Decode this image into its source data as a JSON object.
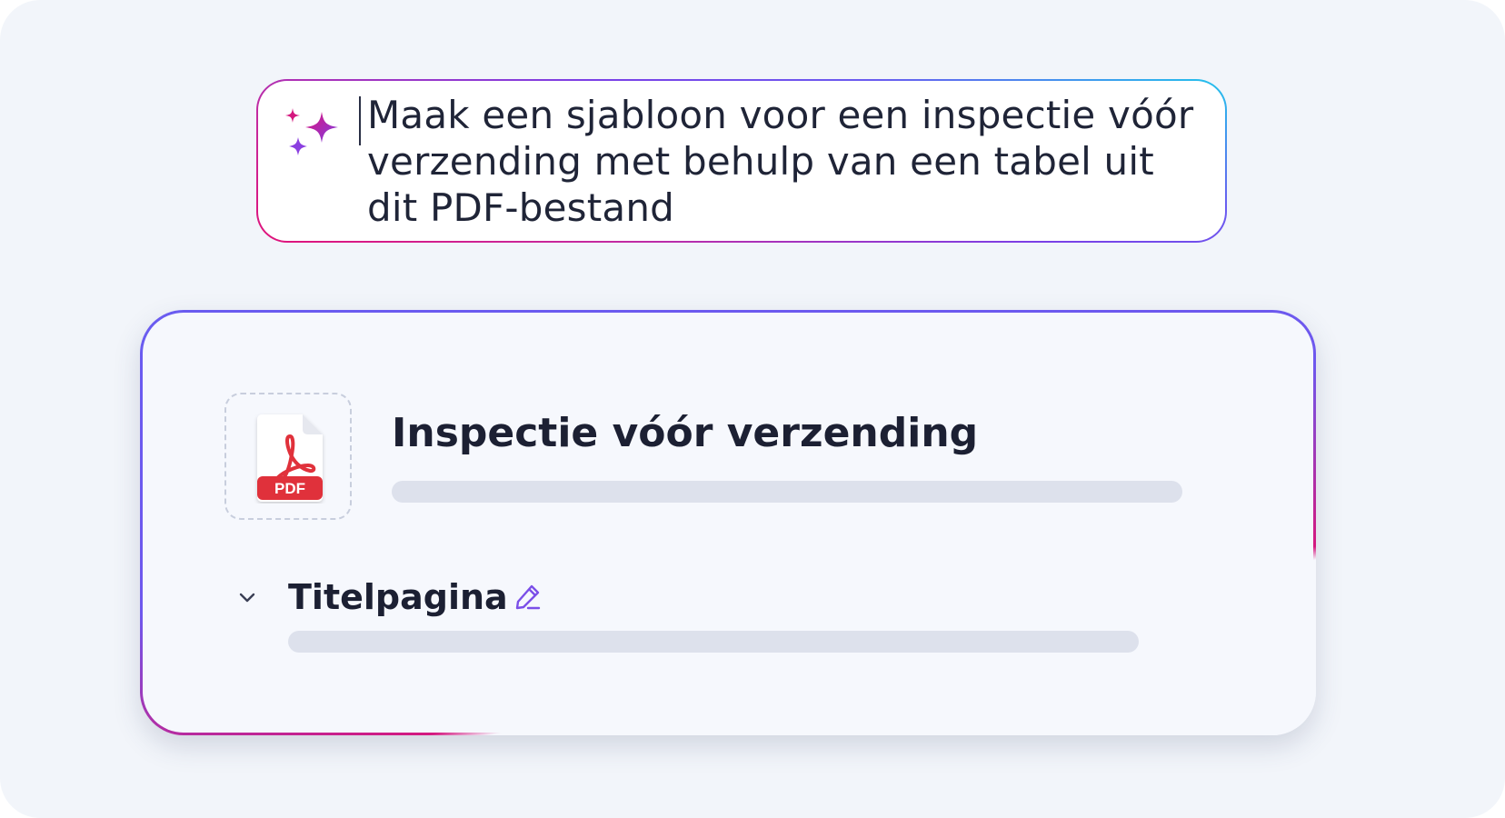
{
  "prompt": {
    "text": "Maak een sjabloon voor een inspectie vóór verzending met behulp van een tabel uit dit PDF-bestand",
    "icon": "sparkles-icon"
  },
  "card": {
    "file_icon": "pdf-file-icon",
    "file_badge": "PDF",
    "title": "Inspectie vóór verzending",
    "section": {
      "expand_icon": "chevron-down-icon",
      "title": "Titelpagina",
      "edit_icon": "pencil-icon"
    }
  },
  "colors": {
    "accent_purple": "#6a5cf0",
    "accent_pink": "#e0137a",
    "accent_cyan": "#22c4ec",
    "pdf_red": "#e0313b"
  }
}
